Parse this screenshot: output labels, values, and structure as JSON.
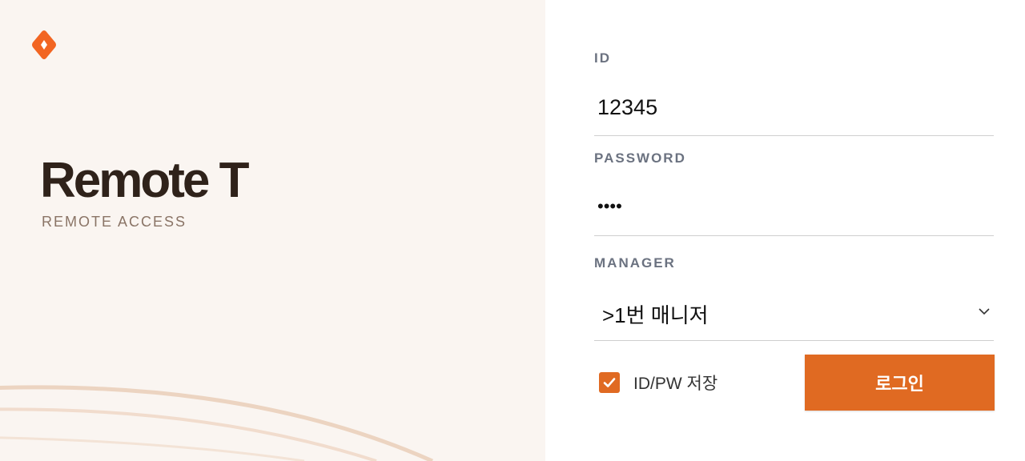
{
  "brand": {
    "logo_icon": "orange-diamond-logo",
    "title": "Remote T",
    "subtitle": "REMOTE ACCESS"
  },
  "form": {
    "id_label": "ID",
    "id_value": "12345",
    "password_label": "PASSWORD",
    "password_value": "1234",
    "manager_label": "MANAGER",
    "manager_selected": ">1번 매니저",
    "remember_label": "ID/PW 저장",
    "remember_checked": true,
    "login_label": "로그인"
  },
  "colors": {
    "accent": "#e06a22",
    "brand_panel_bg": "#faf5f1",
    "title_color": "#2f221a",
    "label_color": "#6b7280"
  }
}
